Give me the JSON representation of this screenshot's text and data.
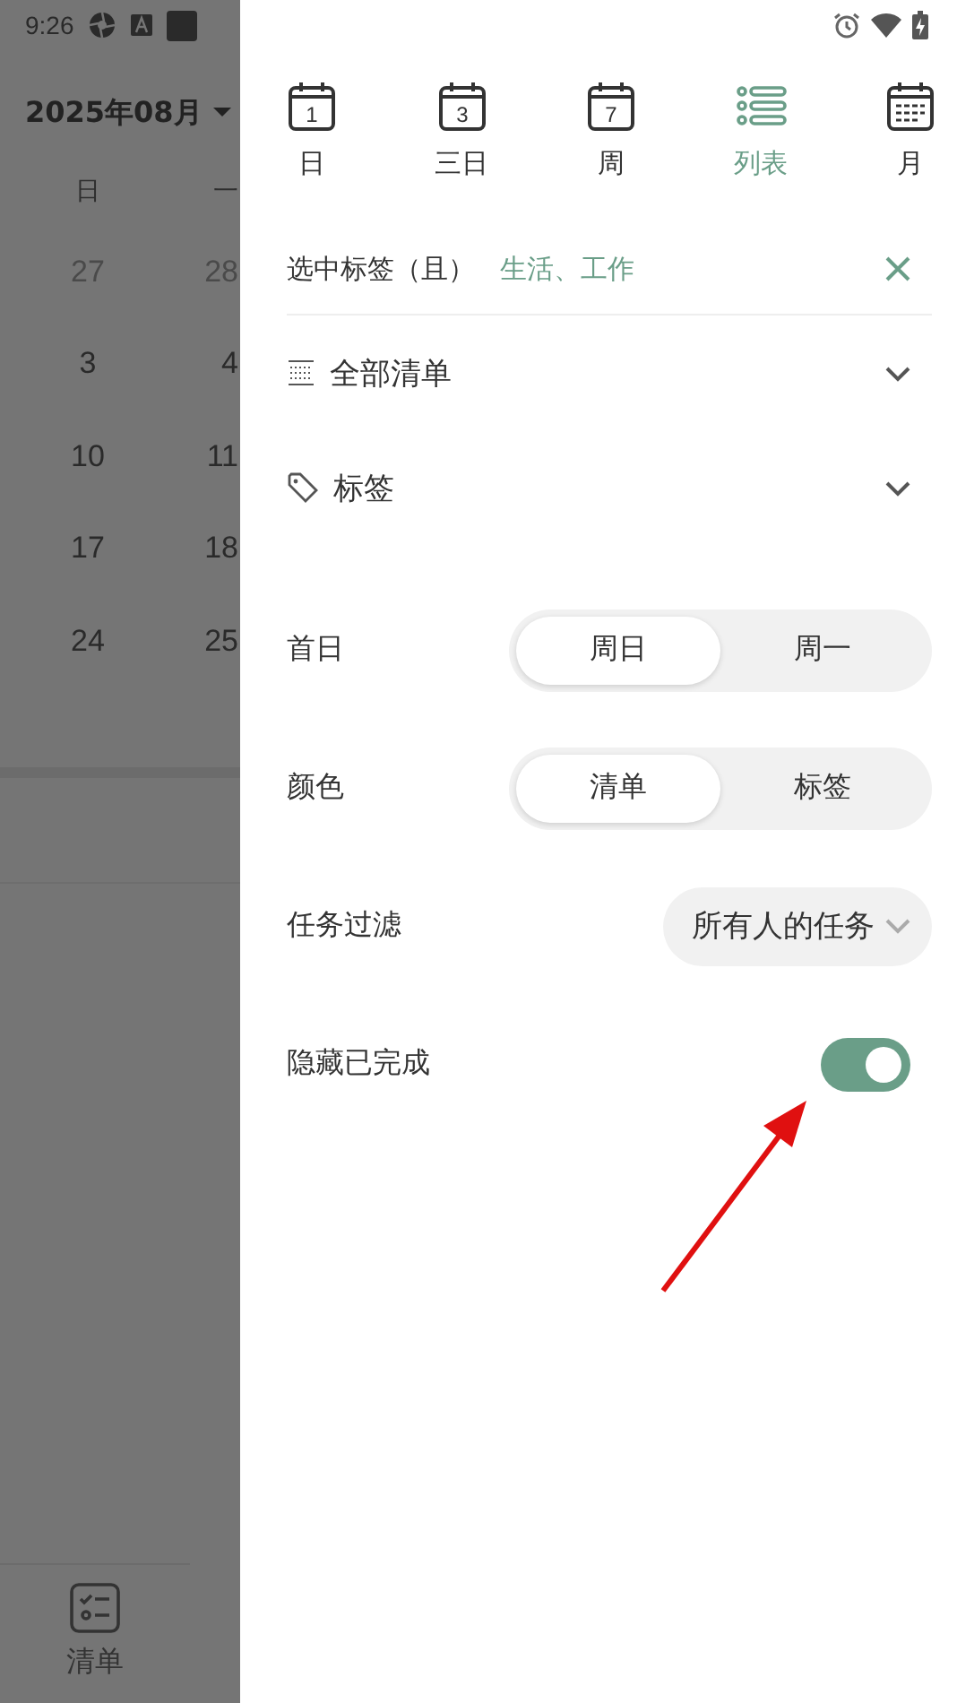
{
  "status_bar": {
    "time": "9:26"
  },
  "calendar": {
    "month": "2025年08月",
    "weekdays": [
      "日",
      "一"
    ],
    "weeks": [
      [
        {
          "day": "27",
          "other_month": true
        },
        {
          "day": "28",
          "other_month": true
        }
      ],
      [
        {
          "day": "3",
          "other_month": false
        },
        {
          "day": "4",
          "other_month": false
        }
      ],
      [
        {
          "day": "10",
          "other_month": false
        },
        {
          "day": "11",
          "other_month": false
        }
      ],
      [
        {
          "day": "17",
          "other_month": false
        },
        {
          "day": "18",
          "other_month": false
        }
      ],
      [
        {
          "day": "24",
          "other_month": false
        },
        {
          "day": "25",
          "other_month": false
        }
      ]
    ]
  },
  "bottom_nav": [
    {
      "label": "清单"
    }
  ],
  "drawer": {
    "views": [
      {
        "label": "日",
        "kind": "calendar",
        "number": "1",
        "selected": false
      },
      {
        "label": "三日",
        "kind": "calendar",
        "number": "3",
        "selected": false
      },
      {
        "label": "周",
        "kind": "calendar",
        "number": "7",
        "selected": false
      },
      {
        "label": "列表",
        "kind": "list",
        "selected": true
      },
      {
        "label": "月",
        "kind": "month",
        "selected": false
      }
    ],
    "tag_filter": {
      "label": "选中标签（且）",
      "value": "生活、工作"
    },
    "sections": [
      {
        "label": "全部清单",
        "kind": "list"
      },
      {
        "label": "标签",
        "kind": "tag"
      }
    ],
    "settings": [
      {
        "kind": "segmented",
        "label": "首日",
        "options": [
          {
            "label": "周日",
            "selected": true
          },
          {
            "label": "周一",
            "selected": false
          }
        ]
      },
      {
        "kind": "segmented",
        "label": "颜色",
        "options": [
          {
            "label": "清单",
            "selected": true
          },
          {
            "label": "标签",
            "selected": false
          }
        ]
      },
      {
        "kind": "dropdown",
        "label": "任务过滤",
        "value": "所有人的任务"
      },
      {
        "kind": "toggle",
        "label": "隐藏已完成",
        "on": true
      }
    ]
  },
  "annotation": {
    "kind": "arrow"
  }
}
